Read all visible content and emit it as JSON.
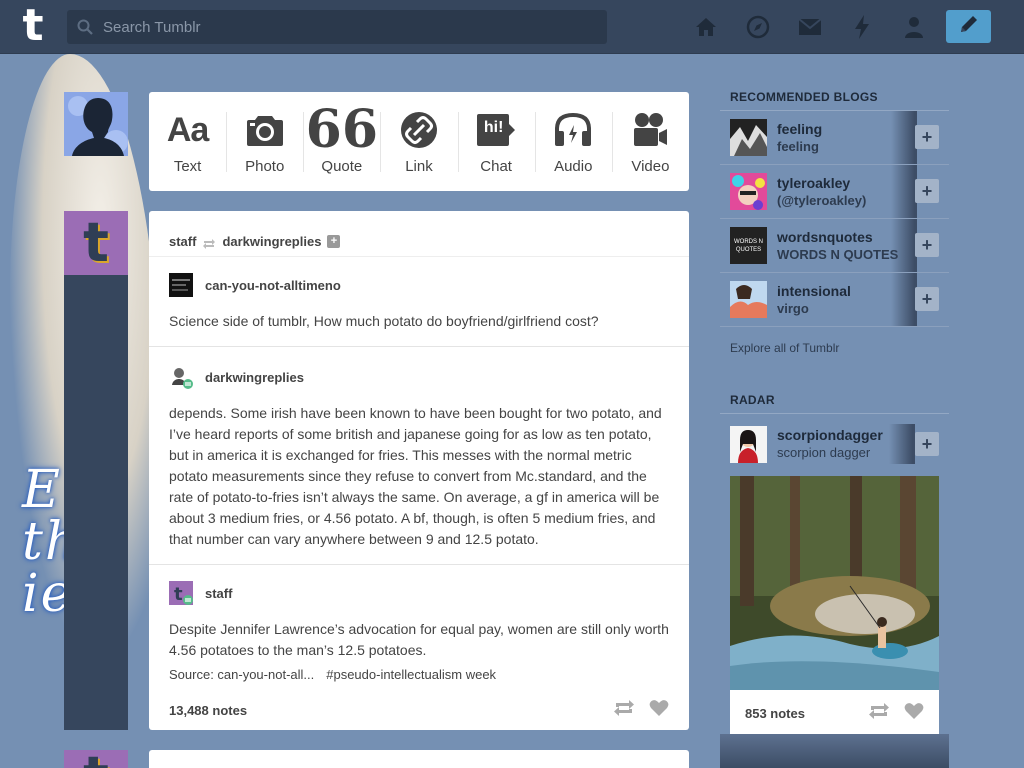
{
  "header": {
    "logo_text": "t",
    "search_placeholder": "Search Tumblr",
    "nav_icons": [
      "home-icon",
      "compass-icon",
      "mail-icon",
      "lightning-icon",
      "person-icon"
    ],
    "compose_icon": "pencil-icon"
  },
  "background": {
    "text": "E w the ie"
  },
  "post_types": [
    {
      "label": "Text",
      "icon": "text-icon",
      "glyph": "Aa",
      "color": "#444444"
    },
    {
      "label": "Photo",
      "icon": "camera-icon",
      "color": "#444444"
    },
    {
      "label": "Quote",
      "icon": "quote-icon",
      "glyph": "66",
      "color": "#444444"
    },
    {
      "label": "Link",
      "icon": "link-icon",
      "color": "#444444"
    },
    {
      "label": "Chat",
      "icon": "chat-icon",
      "glyph": "hi!",
      "color": "#444444"
    },
    {
      "label": "Audio",
      "icon": "headphones-icon",
      "color": "#444444"
    },
    {
      "label": "Video",
      "icon": "video-camera-icon",
      "color": "#444444"
    }
  ],
  "post": {
    "header": {
      "poster": "staff",
      "reblogged_from": "darkwingreplies"
    },
    "segments": [
      {
        "user": "can-you-not-alltimeno",
        "body": "Science side of tumblr, How much potato do boyfriend/girlfriend cost?"
      },
      {
        "user": "darkwingreplies",
        "body": "depends. Some irish have been known to have been bought for two potato, and I’ve heard reports of some british and japanese going for as low as ten potato, but in america it is exchanged for fries. This messes with the normal metric potato measurements since they refuse to convert from Mc.standard, and the rate of potato-to-fries isn’t always the same. On average, a gf in america will be about 3 medium fries, or 4.56 potato. A bf, though, is often 5 medium fries, and that number can vary anywhere between 9 and 12.5 potato."
      },
      {
        "user": "staff",
        "body": "Despite Jennifer Lawrence’s advocation for equal pay, women are still only worth 4.56 potatoes to the man’s 12.5 potatoes."
      }
    ],
    "source": "Source: can-you-not-all...",
    "tag": "#pseudo-intellectualism week",
    "notes": "13,488 notes"
  },
  "sidebar": {
    "recommended_heading": "RECOMMENDED BLOGS",
    "blogs": [
      {
        "name": "feeling",
        "subtitle": "feeling"
      },
      {
        "name": "tyleroakley",
        "subtitle": "(@tyleroakley)"
      },
      {
        "name": "wordsnquotes",
        "subtitle": "WORDS N QUOTES",
        "avatar_text": "WORDS N QUOTES"
      },
      {
        "name": "intensional",
        "subtitle": "virgo"
      }
    ],
    "explore": "Explore all of Tumblr",
    "radar_heading": "RADAR",
    "radar": {
      "name": "scorpiondagger",
      "subtitle": "scorpion dagger",
      "notes": "853 notes"
    }
  },
  "colors": {
    "nav_bg": "#36465d",
    "page_bg": "#7590b3",
    "accent": "#529ecc",
    "staff_purple": "#9b6db5"
  }
}
